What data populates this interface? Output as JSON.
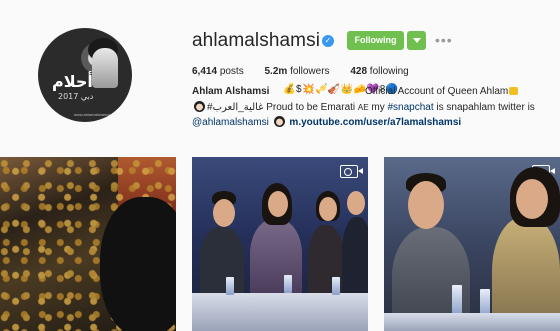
{
  "profile": {
    "username": "ahlamalshamsi",
    "verified_glyph": "✓",
    "avatar": {
      "name_arabic": "أحلام",
      "subtitle_arabic": "دبي 2017",
      "url_text": "www.ahlamalshamsi.com"
    },
    "follow_button": "Following",
    "more_glyph": "•••"
  },
  "stats": {
    "posts_value": "6,414",
    "posts_label": "posts",
    "followers_value": "5.2m",
    "followers_label": "followers",
    "following_value": "428",
    "following_label": "following"
  },
  "bio": {
    "full_name": "Ahlam Alshamsi",
    "emoji_run": "💰$💥🎺🎻👑🧀💜8🔵",
    "line1": "Official Account of Queen Ahlam",
    "line2_a": "#غالية_العرب",
    "line2_b": "Proud to be Emarati ",
    "line2_flag": "AE",
    "line2_c": " my ",
    "line2_hashtag": "#snapchat",
    "line2_d": " is snapahlam twitter is",
    "line3_handle": "@ahlamalshamsi",
    "line3_link": "m.youtube.com/user/a7lamalshamsi"
  },
  "icons": {
    "verified": "verified-badge-icon",
    "more": "more-options-icon",
    "video": "video-icon",
    "caret": "chevron-down-icon"
  },
  "colors": {
    "accent_green": "#70c050",
    "verified_blue": "#3897f0",
    "link_blue": "#003569"
  }
}
